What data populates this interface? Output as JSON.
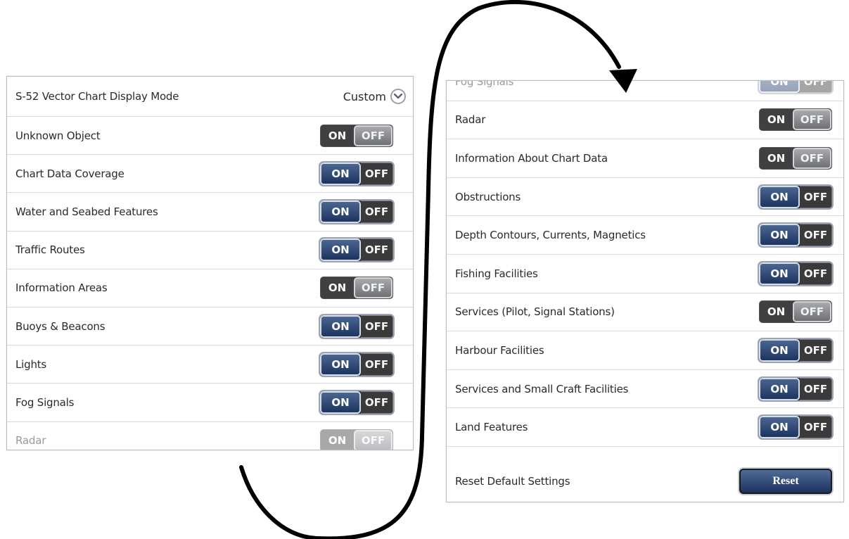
{
  "left_panel": {
    "header": {
      "label": "S-52 Vector Chart Display Mode",
      "mode_value": "Custom"
    },
    "rows": [
      {
        "label": "Unknown Object",
        "state": "off",
        "on_label": "ON",
        "off_label": "OFF"
      },
      {
        "label": "Chart Data Coverage",
        "state": "on",
        "on_label": "ON",
        "off_label": "OFF"
      },
      {
        "label": "Water and Seabed Features",
        "state": "on",
        "on_label": "ON",
        "off_label": "OFF"
      },
      {
        "label": "Traffic Routes",
        "state": "on",
        "on_label": "ON",
        "off_label": "OFF"
      },
      {
        "label": "Information Areas",
        "state": "off",
        "on_label": "ON",
        "off_label": "OFF"
      },
      {
        "label": "Buoys & Beacons",
        "state": "on",
        "on_label": "ON",
        "off_label": "OFF"
      },
      {
        "label": "Lights",
        "state": "on",
        "on_label": "ON",
        "off_label": "OFF"
      },
      {
        "label": "Fog Signals",
        "state": "on",
        "on_label": "ON",
        "off_label": "OFF"
      },
      {
        "label": "Radar",
        "state": "off",
        "on_label": "ON",
        "off_label": "OFF"
      }
    ]
  },
  "right_panel": {
    "rows": [
      {
        "label": "Fog Signals",
        "state": "on",
        "on_label": "ON",
        "off_label": "OFF"
      },
      {
        "label": "Radar",
        "state": "off",
        "on_label": "ON",
        "off_label": "OFF"
      },
      {
        "label": "Information About Chart Data",
        "state": "off",
        "on_label": "ON",
        "off_label": "OFF"
      },
      {
        "label": "Obstructions",
        "state": "on",
        "on_label": "ON",
        "off_label": "OFF"
      },
      {
        "label": "Depth Contours, Currents, Magnetics",
        "state": "on",
        "on_label": "ON",
        "off_label": "OFF"
      },
      {
        "label": "Fishing Facilities",
        "state": "on",
        "on_label": "ON",
        "off_label": "OFF"
      },
      {
        "label": "Services (Pilot, Signal Stations)",
        "state": "off",
        "on_label": "ON",
        "off_label": "OFF"
      },
      {
        "label": "Harbour Facilities",
        "state": "on",
        "on_label": "ON",
        "off_label": "OFF"
      },
      {
        "label": "Services and Small Craft Facilities",
        "state": "on",
        "on_label": "ON",
        "off_label": "OFF"
      },
      {
        "label": "Land Features",
        "state": "on",
        "on_label": "ON",
        "off_label": "OFF"
      }
    ],
    "reset": {
      "label": "Reset Default Settings",
      "button_label": "Reset"
    }
  },
  "colors": {
    "toggle_on_active": "#1d3560",
    "toggle_off_active": "#8a8c90",
    "reset_button": "#1c325d"
  },
  "icons": {
    "mode_dropdown": "chevron-down-icon",
    "scroll_arrow": "curved-arrow-icon"
  }
}
